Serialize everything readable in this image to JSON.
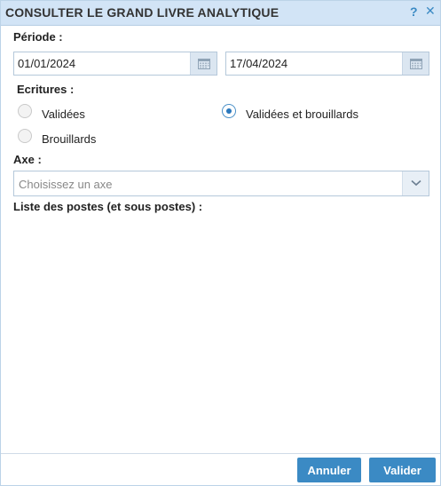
{
  "dialog": {
    "title": "CONSULTER LE GRAND LIVRE ANALYTIQUE",
    "help_glyph": "?",
    "close_glyph": "✕"
  },
  "periode": {
    "label": "Période :",
    "start_date": "01/01/2024",
    "end_date": "17/04/2024"
  },
  "ecritures": {
    "label": "Ecritures :",
    "options": [
      {
        "label": "Validées",
        "checked": false
      },
      {
        "label": "Validées et brouillards",
        "checked": true
      },
      {
        "label": "Brouillards",
        "checked": false
      }
    ]
  },
  "axe": {
    "label": "Axe :",
    "placeholder": "Choisissez un axe"
  },
  "postes": {
    "label": "Liste des postes (et sous postes) :"
  },
  "buttons": {
    "cancel": "Annuler",
    "submit": "Valider"
  },
  "colors": {
    "titlebar_bg": "#d2e4f6",
    "accent": "#3b8ac4"
  }
}
